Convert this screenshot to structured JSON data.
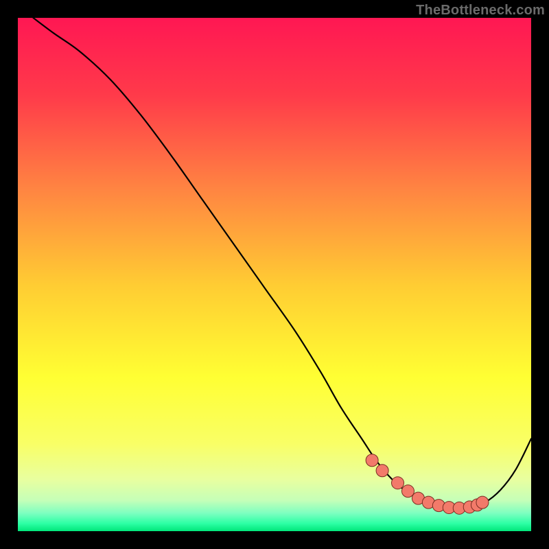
{
  "watermark": "TheBottleneck.com",
  "colors": {
    "frame": "#000000",
    "curve": "#000000",
    "marker_fill": "#f27a6a",
    "marker_stroke": "#7a2d22",
    "gradient_stops": [
      {
        "offset": 0.0,
        "color": "#ff1753"
      },
      {
        "offset": 0.15,
        "color": "#ff3a4a"
      },
      {
        "offset": 0.33,
        "color": "#ff8342"
      },
      {
        "offset": 0.52,
        "color": "#ffcc33"
      },
      {
        "offset": 0.7,
        "color": "#ffff33"
      },
      {
        "offset": 0.83,
        "color": "#f9ff66"
      },
      {
        "offset": 0.9,
        "color": "#e8ffa0"
      },
      {
        "offset": 0.94,
        "color": "#c5ffb8"
      },
      {
        "offset": 0.965,
        "color": "#7dffc0"
      },
      {
        "offset": 0.985,
        "color": "#2dffa5"
      },
      {
        "offset": 1.0,
        "color": "#00e67a"
      }
    ]
  },
  "chart_data": {
    "type": "line",
    "title": "",
    "xlabel": "",
    "ylabel": "",
    "xlim": [
      0,
      100
    ],
    "ylim": [
      0,
      100
    ],
    "series": [
      {
        "name": "bottleneck-curve",
        "x": [
          3,
          7,
          12,
          18,
          24,
          30,
          36,
          42,
          48,
          54,
          59,
          63,
          67,
          70,
          73,
          76,
          79,
          82,
          85,
          88,
          91,
          94,
          97,
          100
        ],
        "y": [
          100,
          97,
          93.5,
          88,
          81,
          73,
          64.5,
          56,
          47.5,
          39,
          31,
          24,
          18,
          13.5,
          10,
          7.5,
          5.8,
          4.8,
          4.4,
          4.6,
          5.6,
          8,
          12,
          18
        ]
      }
    ],
    "markers": {
      "name": "highlighted-points",
      "x": [
        69,
        71,
        74,
        76,
        78,
        80,
        82,
        84,
        86,
        88,
        89.5,
        90.5
      ],
      "y": [
        13.8,
        11.8,
        9.4,
        7.8,
        6.4,
        5.6,
        5.0,
        4.6,
        4.5,
        4.7,
        5.1,
        5.6
      ]
    }
  }
}
